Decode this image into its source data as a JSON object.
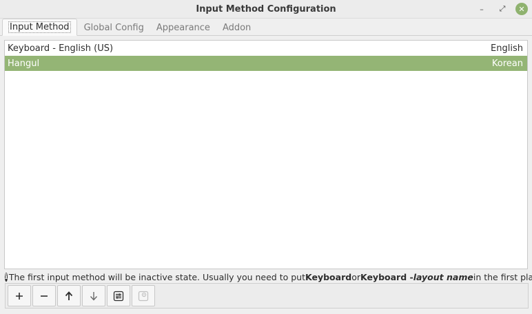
{
  "window": {
    "title": "Input Method Configuration",
    "minimize_glyph": "–",
    "maximize_glyph": "⤢",
    "close_glyph": "✕"
  },
  "tabs": [
    {
      "label": "Input Method"
    },
    {
      "label": "Global Config"
    },
    {
      "label": "Appearance"
    },
    {
      "label": "Addon"
    }
  ],
  "input_methods": [
    {
      "name": "Keyboard - English (US)",
      "language": "English",
      "selected": false
    },
    {
      "name": "Hangul",
      "language": "Korean",
      "selected": true
    }
  ],
  "info": {
    "icon_glyph": "i",
    "part1": "The first input method will be inactive state. Usually you need to put ",
    "bold1": "Keyboard",
    "part2": " or ",
    "bold2": "Keyboard - ",
    "italic": "layout name",
    "part3": " in the first place."
  },
  "toolbar": {
    "buttons": [
      {
        "name": "add",
        "icon": "plus-icon"
      },
      {
        "name": "remove",
        "icon": "minus-icon"
      },
      {
        "name": "move-up",
        "icon": "arrow-up-icon"
      },
      {
        "name": "move-down",
        "icon": "arrow-down-icon"
      },
      {
        "name": "configure",
        "icon": "settings-panel-icon"
      },
      {
        "name": "keyboard-layout",
        "icon": "keyboard-layout-icon",
        "disabled": true
      }
    ]
  },
  "colors": {
    "selection": "#94b575",
    "close_button": "#8fb26f"
  }
}
